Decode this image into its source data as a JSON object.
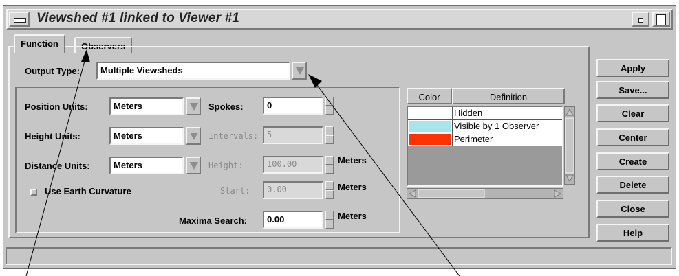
{
  "window": {
    "title": "Viewshed #1 linked to Viewer #1"
  },
  "tabs": [
    {
      "label": "Function",
      "active": true
    },
    {
      "label": "Observers",
      "active": false
    }
  ],
  "output_type": {
    "label": "Output Type:",
    "value": "Multiple Viewsheds"
  },
  "units": {
    "position_label": "Position Units:",
    "position_value": "Meters",
    "height_label": "Height Units:",
    "height_value": "Meters",
    "distance_label": "Distance Units:",
    "distance_value": "Meters"
  },
  "earth_curvature": {
    "label": "Use Earth Curvature",
    "checked": false
  },
  "spokes": {
    "label": "Spokes:",
    "value": "0"
  },
  "intervals": {
    "label": "Intervals:",
    "value": "5"
  },
  "height": {
    "label": "Height:",
    "value": "100.00",
    "unit": "Meters"
  },
  "start": {
    "label": "Start:",
    "value": "0.00",
    "unit": "Meters"
  },
  "maxima": {
    "label": "Maxima Search:",
    "value": "0.00",
    "unit": "Meters"
  },
  "table": {
    "headers": [
      "Color",
      "Definition"
    ],
    "rows": [
      {
        "color": "#ffffff",
        "definition": "Hidden"
      },
      {
        "color": "#a6e6ea",
        "definition": "Visible by 1 Observer"
      },
      {
        "color": "#ff3300",
        "definition": "Perimeter"
      }
    ]
  },
  "buttons": {
    "apply": "Apply",
    "save": "Save...",
    "clear": "Clear",
    "center": "Center",
    "create": "Create",
    "delete": "Delete",
    "close": "Close",
    "help": "Help"
  },
  "colors": {
    "window_bg": "#c6c6c6",
    "callout_lines": "#000000"
  },
  "icons": {
    "window_menu": "window-menu-icon",
    "minimize": "minimize-icon",
    "maximize": "maximize-icon",
    "dropdown": "dropdown-arrow-icon"
  }
}
